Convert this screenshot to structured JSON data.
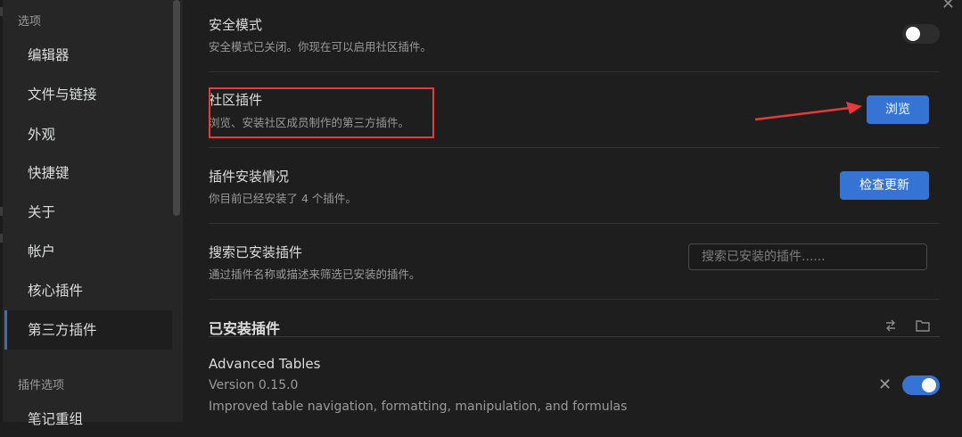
{
  "sidebar": {
    "section_options": "选项",
    "items": [
      {
        "label": "编辑器"
      },
      {
        "label": "文件与链接"
      },
      {
        "label": "外观"
      },
      {
        "label": "快捷键"
      },
      {
        "label": "关于"
      },
      {
        "label": "帐户"
      },
      {
        "label": "核心插件"
      },
      {
        "label": "第三方插件"
      }
    ],
    "active_index": 7,
    "section_plugin_options": "插件选项",
    "partial_item": "笔记重组"
  },
  "settings": {
    "safe_mode": {
      "name": "安全模式",
      "desc": "安全模式已关闭。你现在可以启用社区插件。",
      "toggle_on": false
    },
    "community_plugins": {
      "name": "社区插件",
      "desc": "浏览、安装社区成员制作的第三方插件。",
      "button": "浏览"
    },
    "plugin_status": {
      "name": "插件安装情况",
      "desc": "你目前已经安装了 4 个插件。",
      "button": "检查更新"
    },
    "search_installed": {
      "name": "搜索已安装插件",
      "desc": "通过插件名称或描述来筛选已安装的插件。",
      "placeholder": "搜索已安装的插件......",
      "value": ""
    }
  },
  "installed": {
    "heading": "已安装插件",
    "plugins": [
      {
        "name": "Advanced Tables",
        "version": "Version 0.15.0",
        "desc": "Improved table navigation, formatting, manipulation, and formulas",
        "enabled": true
      }
    ]
  },
  "colors": {
    "accent": "#3574d4",
    "annotation_red": "#e8393b",
    "background": "#1e1e1e",
    "sidebar": "#262626"
  },
  "icons": [
    "close-icon",
    "reload-icon",
    "folder-icon",
    "remove-icon"
  ]
}
